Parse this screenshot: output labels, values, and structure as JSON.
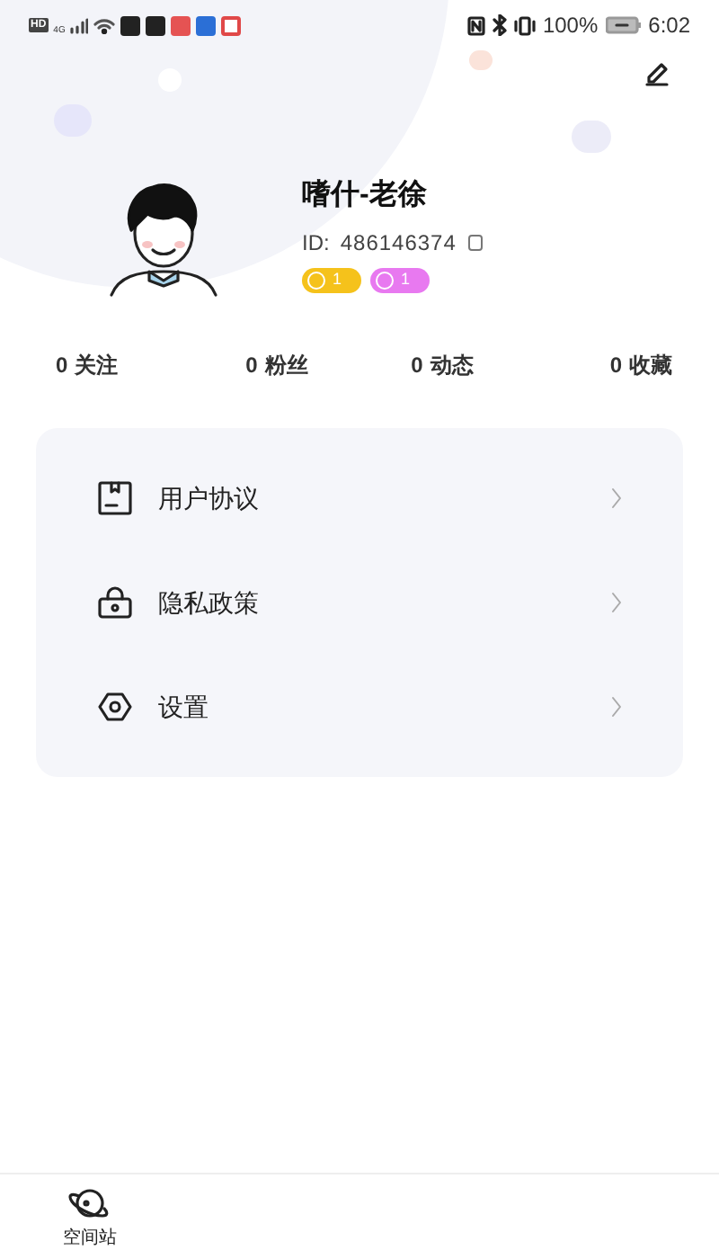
{
  "status_bar": {
    "hd": "HD",
    "network": "4G",
    "battery": "100%",
    "time": "6:02"
  },
  "profile": {
    "name": "嗜什-老徐",
    "id_label": "ID:",
    "id": "486146374",
    "badges": [
      {
        "text": "1",
        "color": "#f5c21b"
      },
      {
        "text": "1",
        "color": "#e879f0"
      }
    ]
  },
  "stats": [
    {
      "count": "0",
      "label": "关注"
    },
    {
      "count": "0",
      "label": "粉丝"
    },
    {
      "count": "0",
      "label": "动态"
    },
    {
      "count": "0",
      "label": "收藏"
    }
  ],
  "menu": [
    {
      "kind": "agreement",
      "label": "用户协议"
    },
    {
      "kind": "privacy",
      "label": "隐私政策"
    },
    {
      "kind": "settings",
      "label": "设置"
    }
  ],
  "bottom_nav": [
    {
      "label": "空间站"
    }
  ]
}
